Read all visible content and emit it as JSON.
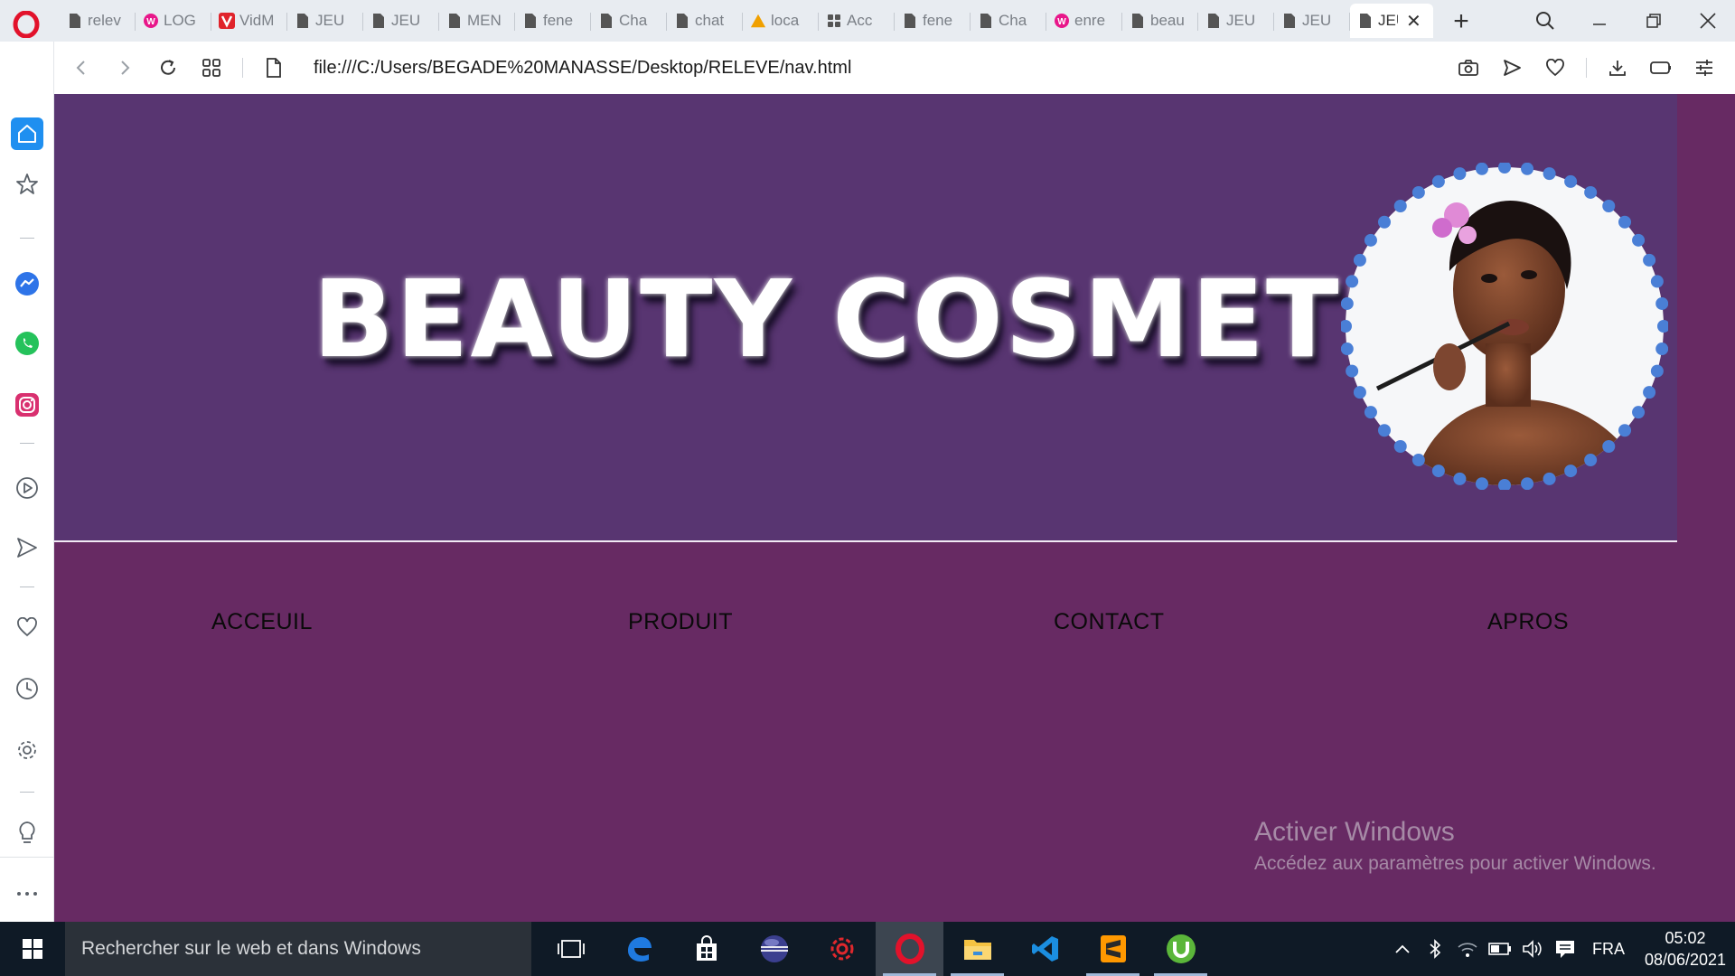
{
  "browser": {
    "tabs": [
      {
        "label": "relev",
        "icon": "document-icon"
      },
      {
        "label": "LOG",
        "icon": "webcomics-icon"
      },
      {
        "label": "VidM",
        "icon": "vidmate-icon"
      },
      {
        "label": "JEU",
        "icon": "document-icon"
      },
      {
        "label": "JEU",
        "icon": "document-icon"
      },
      {
        "label": "MEN",
        "icon": "document-icon"
      },
      {
        "label": "fene",
        "icon": "document-icon"
      },
      {
        "label": "Cha",
        "icon": "document-icon"
      },
      {
        "label": "chat",
        "icon": "document-icon"
      },
      {
        "label": "loca",
        "icon": "pma-icon"
      },
      {
        "label": "Acc",
        "icon": "grid-icon"
      },
      {
        "label": "fene",
        "icon": "document-icon"
      },
      {
        "label": "Cha",
        "icon": "document-icon"
      },
      {
        "label": "enre",
        "icon": "webcomics-icon"
      },
      {
        "label": "beau",
        "icon": "document-icon"
      },
      {
        "label": "JEU",
        "icon": "document-icon"
      },
      {
        "label": "JEU",
        "icon": "document-icon"
      },
      {
        "label": "JEU",
        "icon": "document-icon",
        "active": true
      }
    ],
    "url": "file:///C:/Users/BEGADE%20MANASSE/Desktop/RELEVE/nav.html"
  },
  "page": {
    "title": "BEAUTY COSMETICS",
    "nav": [
      "ACCEUIL",
      "PRODUIT",
      "CONTACT",
      "APROS"
    ],
    "colors": {
      "banner": "#583571",
      "background": "#672a63",
      "frame_dots": "#4a7fd6"
    }
  },
  "watermark": {
    "title": "Activer Windows",
    "subtitle": "Accédez aux paramètres pour activer Windows."
  },
  "taskbar": {
    "search_placeholder": "Rechercher sur le web et dans Windows",
    "language": "FRA",
    "time": "05:02",
    "date": "08/06/2021"
  }
}
